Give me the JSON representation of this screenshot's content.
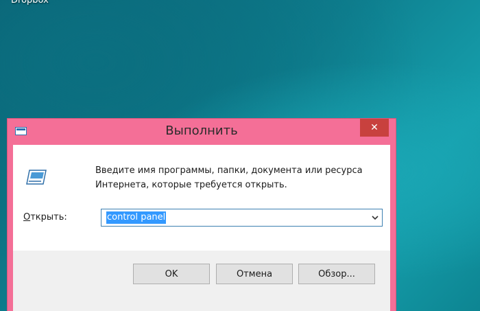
{
  "desktop": {
    "icon_label": "Dropbox"
  },
  "dialog": {
    "title": "Выполнить",
    "close_glyph": "✕",
    "description_line1": "Введите имя программы, папки, документа или ресурса",
    "description_line2": "Интернета, которые требуется открыть.",
    "open_label_accel": "О",
    "open_label_rest": "ткрыть:",
    "open_value": "control panel",
    "buttons": {
      "ok": "OK",
      "cancel": "Отмена",
      "browse": "Обзор..."
    },
    "icons": [
      "run-app-icon",
      "chevron-down-icon",
      "close-icon"
    ]
  },
  "colors": {
    "window_frame": "#f46f97",
    "close_button": "#c8413e",
    "selection": "#3399ff",
    "footer": "#f0f0f0"
  }
}
